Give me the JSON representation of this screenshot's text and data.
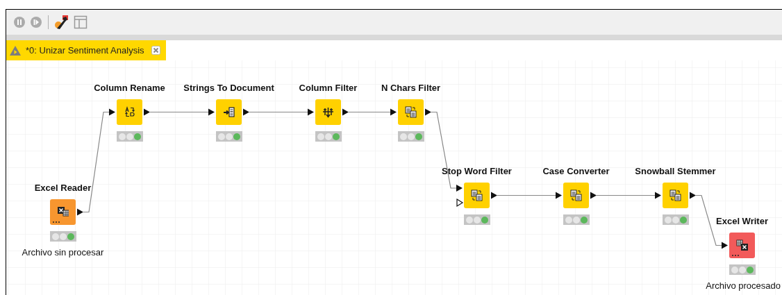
{
  "toolbar": {
    "buttons": [
      {
        "kind": "pause",
        "disabled": true
      },
      {
        "kind": "step",
        "disabled": true
      },
      {
        "kind": "configure",
        "disabled": false
      },
      {
        "kind": "layout",
        "disabled": false
      }
    ]
  },
  "tab": {
    "title": "*0: Unizar Sentiment Analysis",
    "selected": true
  },
  "nodes": [
    {
      "name": "Excel Reader",
      "kind": "reader",
      "executed": true,
      "optional_input": false,
      "annotation": "Archivo sin procesar"
    },
    {
      "name": "Column Rename",
      "kind": "rename",
      "executed": true,
      "optional_input": false
    },
    {
      "name": "Strings To Document",
      "kind": "to-document",
      "executed": true,
      "optional_input": false
    },
    {
      "name": "Column Filter",
      "kind": "column-filter",
      "executed": true,
      "optional_input": false
    },
    {
      "name": "N Chars Filter",
      "kind": "text-processor",
      "executed": true,
      "optional_input": false
    },
    {
      "name": "Stop Word Filter",
      "kind": "text-processor",
      "executed": true,
      "optional_input": true
    },
    {
      "name": "Case Converter",
      "kind": "text-processor",
      "executed": true,
      "optional_input": false
    },
    {
      "name": "Snowball Stemmer",
      "kind": "text-processor",
      "executed": true,
      "optional_input": false
    },
    {
      "name": "Excel Writer",
      "kind": "writer",
      "executed": true,
      "optional_input": false,
      "annotation": "Archivo procesado"
    }
  ]
}
